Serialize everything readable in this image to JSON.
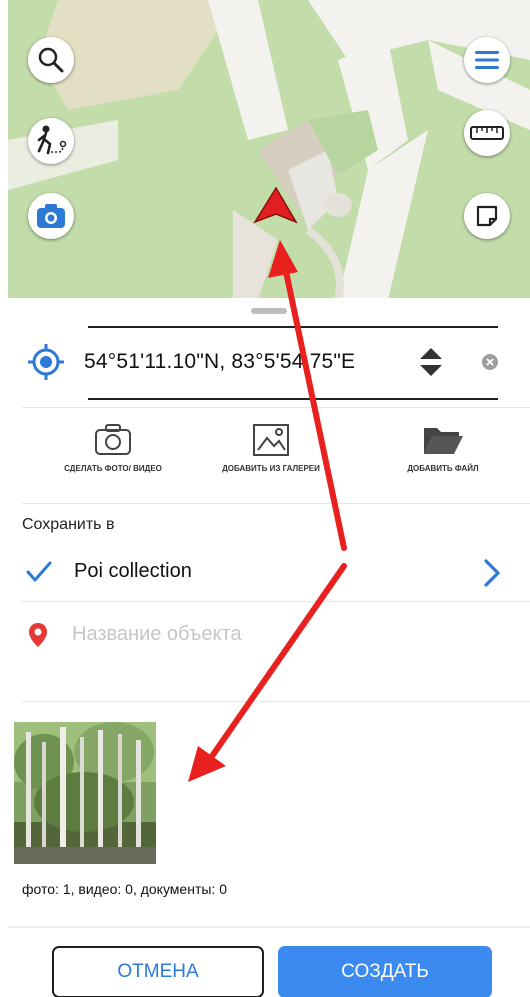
{
  "map": {
    "buttons": {
      "search": "search-icon",
      "route": "walking-route-icon",
      "camera": "camera-icon",
      "menu": "menu-icon",
      "ruler": "ruler-icon",
      "note": "note-icon"
    },
    "colors": {
      "park": "#c2dcaa",
      "road": "#f4f2ee",
      "building": "#d6cfbf",
      "marker": "#e02020"
    }
  },
  "location": {
    "coordinates": "54°51'11.10\"N, 83°5'54.75\"E",
    "locate_icon": "my-location-icon",
    "sort_icon": "sort-arrows-icon",
    "clear_icon": "clear-icon"
  },
  "actions": [
    {
      "label": "Сделать фото/ видео",
      "icon": "camera-icon"
    },
    {
      "label": "Добавить из галереи",
      "icon": "gallery-icon"
    },
    {
      "label": "Добавить файл",
      "icon": "folder-icon"
    }
  ],
  "save": {
    "label": "Сохранить в",
    "collection": "Poi collection"
  },
  "name_field": {
    "placeholder": "Название объекта",
    "value": ""
  },
  "attachments": {
    "counts_text": "фото: 1, видео: 0, документы: 0"
  },
  "buttons": {
    "cancel": "ОТМЕНА",
    "create": "СОЗДАТЬ"
  },
  "colors": {
    "accent": "#3a8af0",
    "annotation_arrow": "#e8211f"
  }
}
